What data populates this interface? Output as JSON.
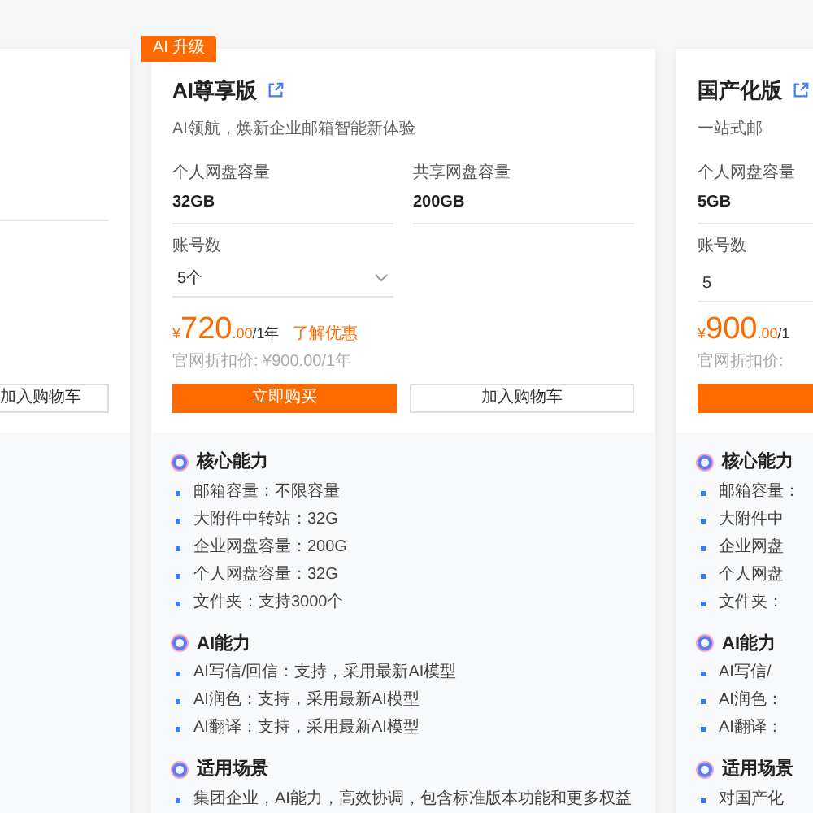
{
  "cards": [
    {
      "cart_button": "加入购物车"
    },
    {
      "badge": "AI 升级",
      "title": "AI尊享版",
      "subtitle": "AI领航，焕新企业邮箱智能新体验",
      "specs": [
        {
          "label": "个人网盘容量",
          "value": "32GB"
        },
        {
          "label": "共享网盘容量",
          "value": "200GB"
        }
      ],
      "accounts": {
        "label": "账号数",
        "value": "5个",
        "kind": "dropdown"
      },
      "price": {
        "currency": "¥",
        "amount": "720",
        "decimals": ".00",
        "unit": "/1年",
        "link": "了解优惠"
      },
      "list_price": "官网折扣价: ¥900.00/1年",
      "buy_button": "立即购买",
      "cart_button": "加入购物车",
      "sections": [
        {
          "title": "核心能力",
          "items": [
            "邮箱容量：不限容量",
            "大附件中转站：32G",
            "企业网盘容量：200G",
            "个人网盘容量：32G",
            "文件夹：支持3000个"
          ]
        },
        {
          "title": "AI能力",
          "items": [
            "AI写信/回信：支持，采用最新AI模型",
            "AI润色：支持，采用最新AI模型",
            "AI翻译：支持，采用最新AI模型"
          ]
        },
        {
          "title": "适用场景",
          "items": [
            "集团企业，AI能力，高效协调，包含标准版本功能和更多权益"
          ]
        }
      ]
    },
    {
      "title": "国产化版",
      "subtitle": "一站式邮",
      "specs": [
        {
          "label": "个人网盘容量",
          "value": "5GB"
        }
      ],
      "accounts": {
        "label": "账号数",
        "value": "5",
        "kind": "input"
      },
      "price": {
        "currency": "¥",
        "amount": "900",
        "decimals": ".00",
        "unit": "/1"
      },
      "list_price": "官网折扣价:",
      "buy_button_visible": true,
      "sections": [
        {
          "title": "核心能力",
          "items": [
            "邮箱容量：",
            "大附件中",
            "企业网盘",
            "个人网盘",
            "文件夹："
          ]
        },
        {
          "title": "AI能力",
          "items": [
            "AI写信/",
            "AI润色：",
            "AI翻译："
          ]
        },
        {
          "title": "适用场景",
          "items": [
            "对国产化"
          ]
        }
      ]
    }
  ]
}
